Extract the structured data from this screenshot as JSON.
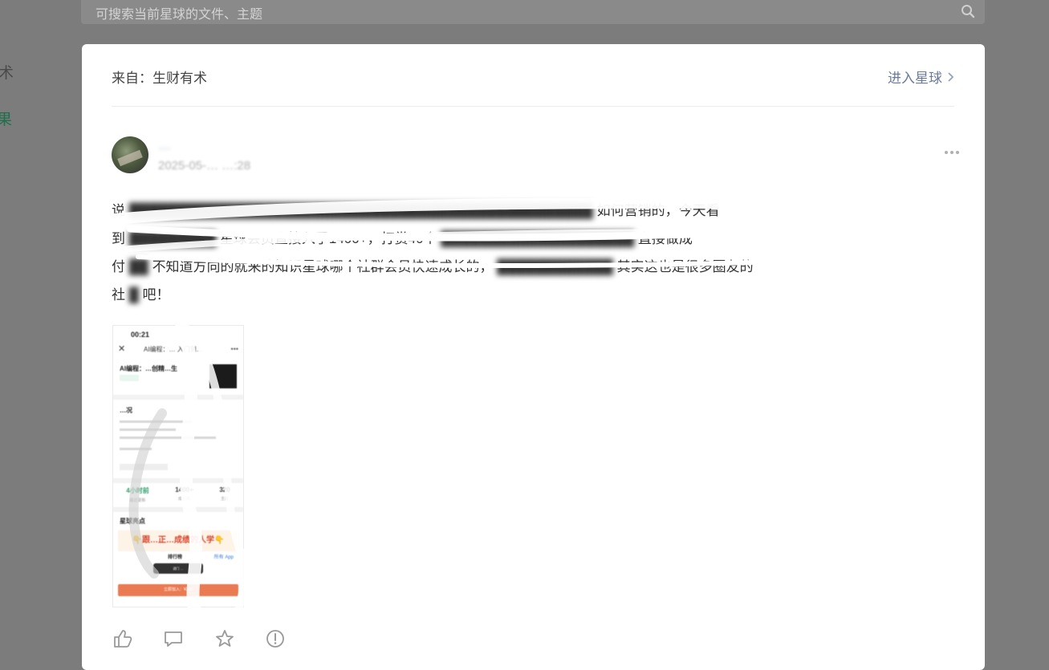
{
  "background": {
    "search_placeholder": "可搜索当前星球的文件、主题",
    "side_label_1": "术",
    "side_label_2": "果"
  },
  "modal": {
    "from_label": "来自：生财有术",
    "enter_link": "进入星球",
    "author": {
      "name": "…",
      "time": "2025-05-… …:28"
    },
    "post_text": {
      "line1_visible_start": "说",
      "line1_visible_end": "如何营销的，今天看",
      "line2_visible_start": "到",
      "line2_visible_mid": "星球会员直接入了1400+，打赏40个",
      "line2_visible_end": "直接做成",
      "line3_visible_start": "付",
      "line3_visible_mid": "不知道方向的就来的知识星球哪个社群会员快速成长的，",
      "line3_visible_end": "其实这也是很多圈友的",
      "line4_visible_start": "社",
      "line4_visible_end": "吧！"
    },
    "screenshot": {
      "status_time": "00:21",
      "title": "AI编程：… 入门到…",
      "headline": "AI编程：…创精…生",
      "section2": "…况",
      "stats": [
        {
          "value": "4小时前",
          "label": "最近更新"
        },
        {
          "value": "1400+",
          "label": "成员数"
        },
        {
          "value": "320",
          "label": "主题"
        }
      ],
      "highlights_title": "星球亮点",
      "banner": "👇跟…正…成绩的人学👇",
      "rank_label": "排行榜",
      "rank_link": "所有 App",
      "popup": "进门 …",
      "pay_button": "立即加入：¥365"
    },
    "actions": [
      "like-icon",
      "comment-icon",
      "star-icon",
      "report-icon"
    ]
  },
  "colors": {
    "overlay": "#7c7c7c",
    "link": "#6b7a99",
    "accent_green": "#1f6e4c",
    "pay_orange": "#ea7a52",
    "banner_red": "#d5472f"
  }
}
